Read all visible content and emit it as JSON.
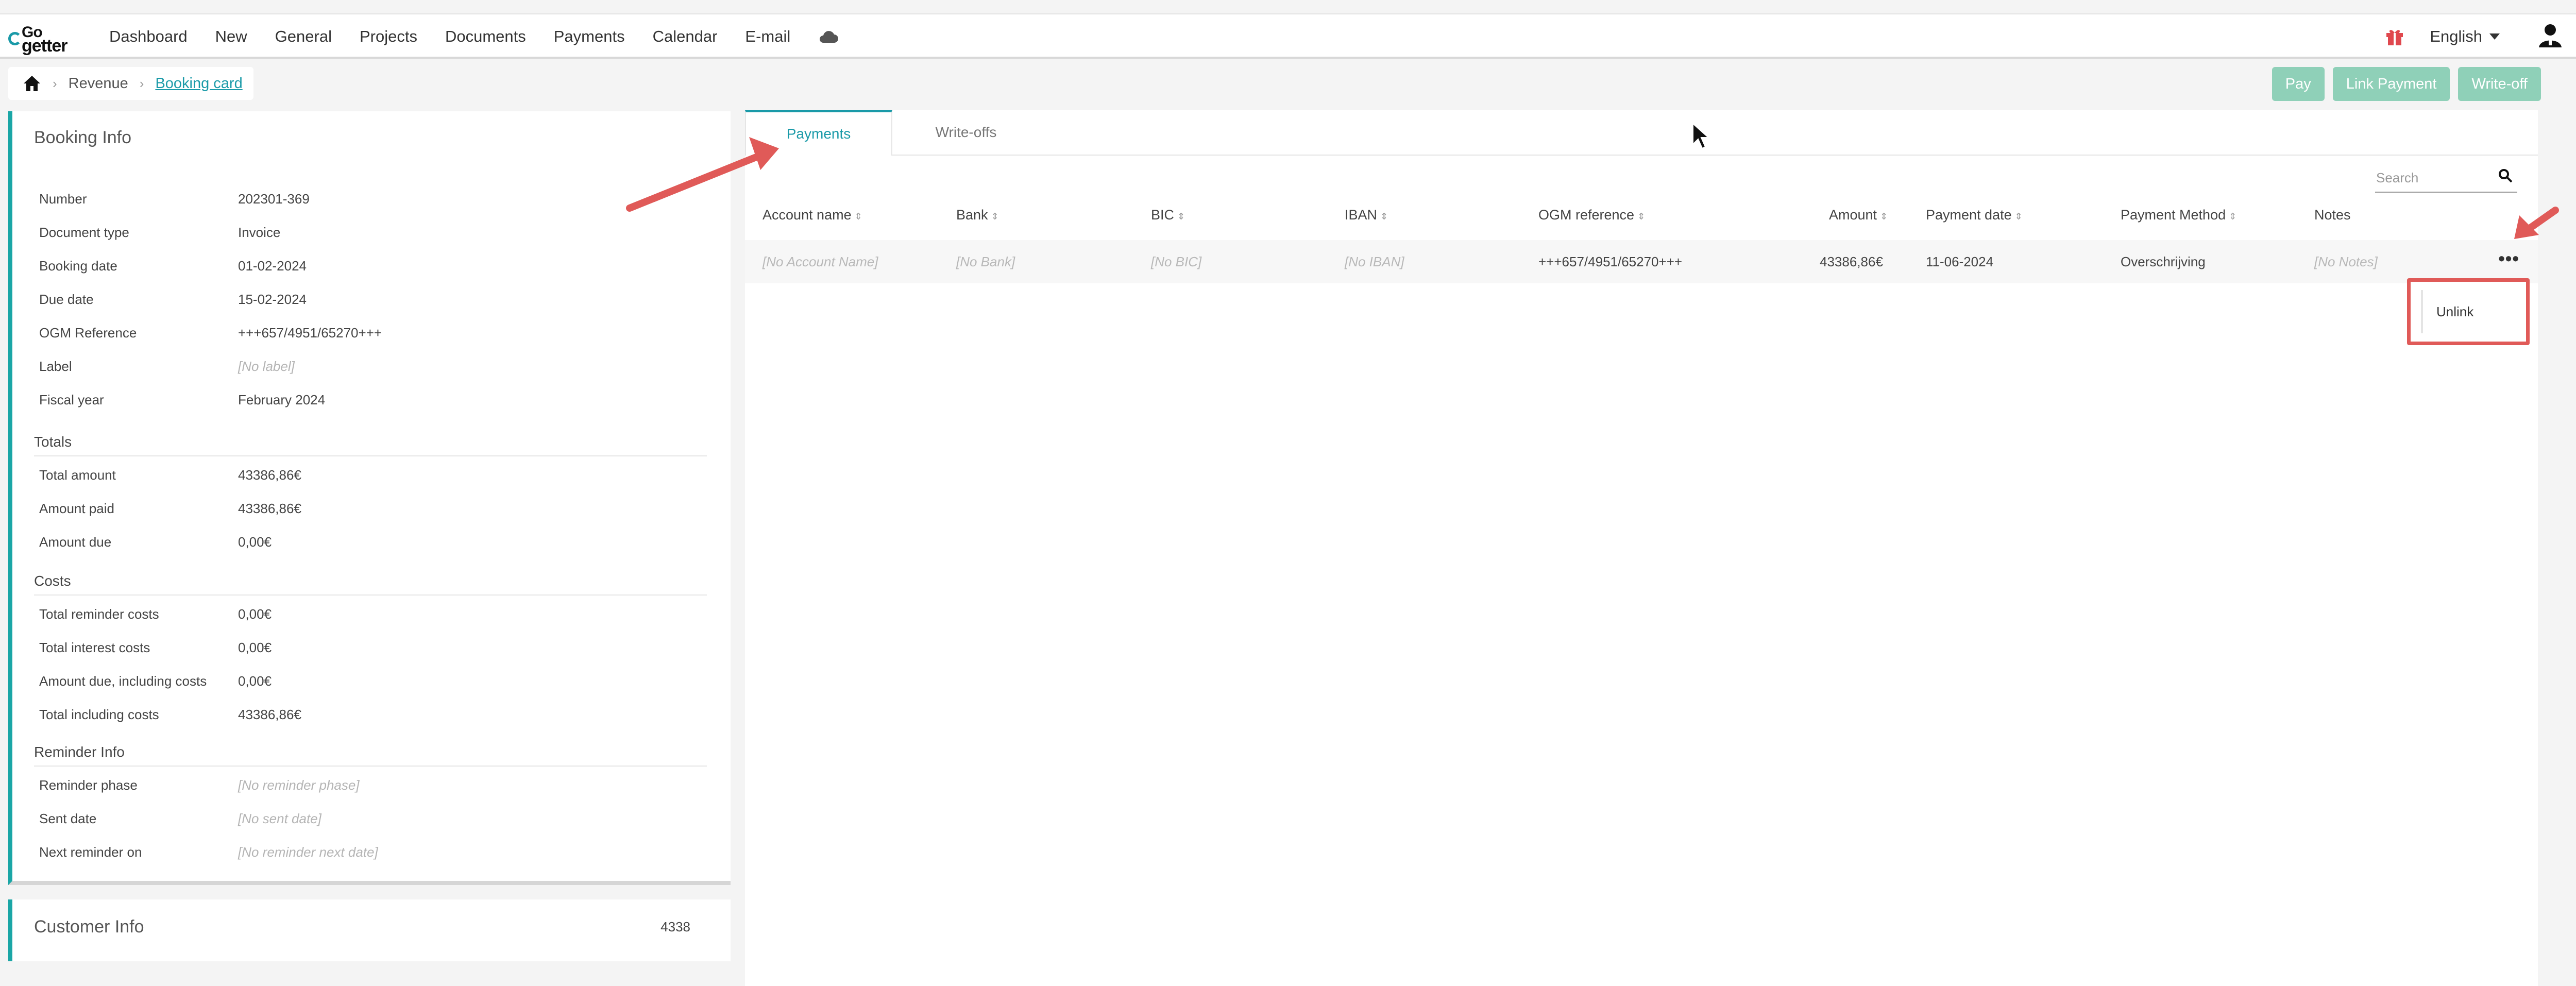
{
  "nav": {
    "logo": {
      "top": "Go",
      "bottom": "getter"
    },
    "items": [
      "Dashboard",
      "New",
      "General",
      "Projects",
      "Documents",
      "Payments",
      "Calendar",
      "E-mail"
    ],
    "language": "English"
  },
  "breadcrumb": {
    "section": "Revenue",
    "current": "Booking card"
  },
  "actions": {
    "pay": "Pay",
    "link_payment": "Link Payment",
    "write_off": "Write-off"
  },
  "booking_info": {
    "title": "Booking Info",
    "fields": [
      {
        "label": "Number",
        "value": "202301-369"
      },
      {
        "label": "Document type",
        "value": "Invoice"
      },
      {
        "label": "Booking date",
        "value": "01-02-2024"
      },
      {
        "label": "Due date",
        "value": "15-02-2024"
      },
      {
        "label": "OGM Reference",
        "value": "+++657/4951/65270+++"
      },
      {
        "label": "Label",
        "value": "[No label]"
      },
      {
        "label": "Fiscal year",
        "value": "February 2024"
      }
    ],
    "totals_title": "Totals",
    "totals": [
      {
        "label": "Total amount",
        "value": "43386,86€"
      },
      {
        "label": "Amount paid",
        "value": "43386,86€"
      },
      {
        "label": "Amount due",
        "value": "0,00€"
      }
    ],
    "costs_title": "Costs",
    "costs": [
      {
        "label": "Total reminder costs",
        "value": "0,00€"
      },
      {
        "label": "Total interest costs",
        "value": "0,00€"
      },
      {
        "label": "Amount due, including costs",
        "value": "0,00€"
      },
      {
        "label": "Total including costs",
        "value": "43386,86€"
      }
    ],
    "reminder_title": "Reminder Info",
    "reminder": [
      {
        "label": "Reminder phase",
        "value": "[No reminder phase]"
      },
      {
        "label": "Sent date",
        "value": "[No sent date]"
      },
      {
        "label": "Next reminder on",
        "value": "[No reminder next date]"
      }
    ]
  },
  "customer_info": {
    "title": "Customer Info",
    "number": "4338"
  },
  "tabs": {
    "payments": "Payments",
    "write_offs": "Write-offs"
  },
  "search": {
    "placeholder": "Search"
  },
  "table": {
    "columns": [
      "Account name",
      "Bank",
      "BIC",
      "IBAN",
      "OGM reference",
      "Amount",
      "Payment date",
      "Payment Method",
      "Notes"
    ],
    "row": {
      "account_name": "[No Account Name]",
      "bank": "[No Bank]",
      "bic": "[No BIC]",
      "iban": "[No IBAN]",
      "ogm_reference": "+++657/4951/65270+++",
      "amount": "43386,86€",
      "payment_date": "11-06-2024",
      "payment_method": "Overschrijving",
      "notes": "[No Notes]",
      "more": "•••"
    }
  },
  "row_menu": {
    "unlink": "Unlink"
  },
  "colors": {
    "accent": "#1a9aa8",
    "button": "#8fd0b8",
    "annotation": "#e05a58"
  }
}
